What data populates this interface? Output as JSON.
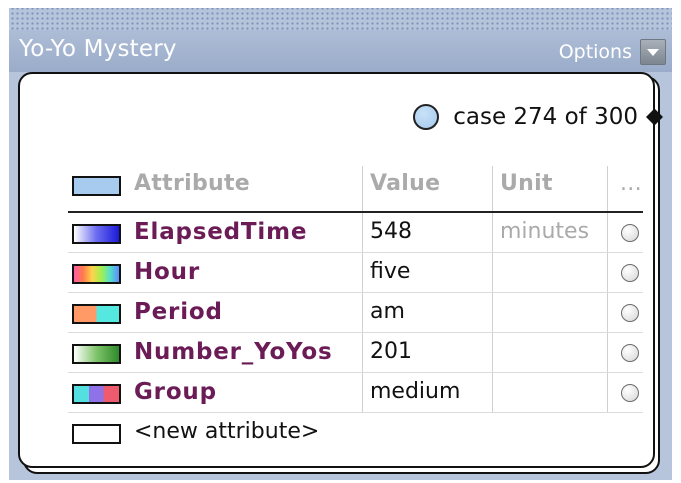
{
  "window": {
    "title": "Yo-Yo Mystery",
    "options_label": "Options"
  },
  "case_nav": {
    "text": "case 274 of 300"
  },
  "table": {
    "columns": [
      "Attribute",
      "Value",
      "Unit",
      "..."
    ],
    "header_swatch_color": "#a7cbef",
    "rows": [
      {
        "name": "ElapsedTime",
        "value": "548",
        "unit": "minutes",
        "swatch": "linear-gradient(90deg,#ffffff,#6c6cf0,#1b1bd9)"
      },
      {
        "name": "Hour",
        "value": "five",
        "unit": "",
        "swatch": "linear-gradient(90deg,#ff5ca8,#ff7a4a,#ffd24d,#a6f04c,#55e0c8,#5a8cff)"
      },
      {
        "name": "Period",
        "value": "am",
        "unit": "",
        "swatch": "linear-gradient(90deg,#ff9966 0 50%,#55e8e0 50% 100%)"
      },
      {
        "name": "Number_YoYos",
        "value": "201",
        "unit": "",
        "swatch": "linear-gradient(90deg,#ffffff,#7ec46a,#2f8a2a)"
      },
      {
        "name": "Group",
        "value": "medium",
        "unit": "",
        "swatch": "linear-gradient(90deg,#55e0e0 0 33%,#8f72e8 33% 66%,#ee5a6e 66% 100%)"
      }
    ],
    "new_attribute_label": "<new attribute>"
  },
  "colors": {
    "attribute_name": "#6b1c57",
    "panel": "#b7c5dc",
    "titlebar": "#9aacca"
  }
}
